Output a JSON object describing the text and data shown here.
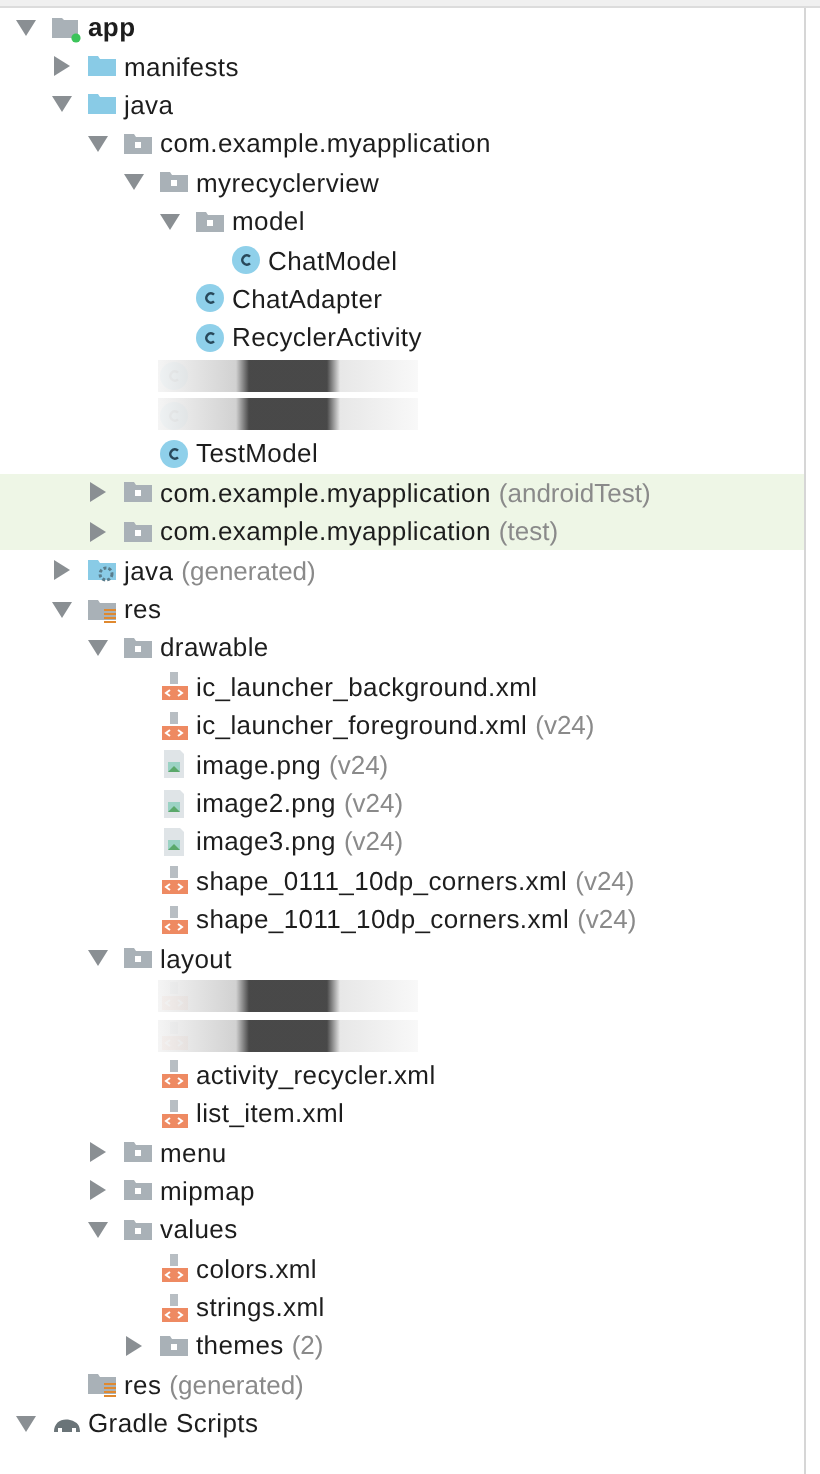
{
  "tree": [
    {
      "kind": "module",
      "label": "app",
      "expanded": true,
      "children": [
        {
          "kind": "folder",
          "label": "manifests",
          "expanded": false
        },
        {
          "kind": "folder",
          "label": "java",
          "expanded": true,
          "children": [
            {
              "kind": "package",
              "label": "com.example.myapplication",
              "expanded": true,
              "children": [
                {
                  "kind": "package",
                  "label": "myrecyclerview",
                  "expanded": true,
                  "children": [
                    {
                      "kind": "package",
                      "label": "model",
                      "expanded": true,
                      "children": [
                        {
                          "kind": "class",
                          "label": "ChatModel"
                        }
                      ]
                    },
                    {
                      "kind": "class",
                      "label": "ChatAdapter"
                    },
                    {
                      "kind": "class",
                      "label": "RecyclerActivity"
                    }
                  ]
                },
                {
                  "kind": "class",
                  "redacted": true
                },
                {
                  "kind": "class",
                  "redacted": true
                },
                {
                  "kind": "class",
                  "label": "TestModel"
                }
              ]
            },
            {
              "kind": "package",
              "label": "com.example.myapplication",
              "suffix": "(androidTest)",
              "expanded": false,
              "highlighted": true
            },
            {
              "kind": "package",
              "label": "com.example.myapplication",
              "suffix": "(test)",
              "expanded": false,
              "highlighted": true
            }
          ]
        },
        {
          "kind": "generated",
          "label": "java",
          "suffix": "(generated)",
          "expanded": false
        },
        {
          "kind": "res",
          "label": "res",
          "expanded": true,
          "children": [
            {
              "kind": "package",
              "label": "drawable",
              "expanded": true,
              "children": [
                {
                  "kind": "xml",
                  "label": "ic_launcher_background.xml"
                },
                {
                  "kind": "xml",
                  "label": "ic_launcher_foreground.xml",
                  "suffix": "(v24)"
                },
                {
                  "kind": "image",
                  "label": "image.png",
                  "suffix": "(v24)"
                },
                {
                  "kind": "image",
                  "label": "image2.png",
                  "suffix": "(v24)"
                },
                {
                  "kind": "image",
                  "label": "image3.png",
                  "suffix": "(v24)"
                },
                {
                  "kind": "xml",
                  "label": "shape_0111_10dp_corners.xml",
                  "suffix": "(v24)"
                },
                {
                  "kind": "xml",
                  "label": "shape_1011_10dp_corners.xml",
                  "suffix": "(v24)"
                }
              ]
            },
            {
              "kind": "package",
              "label": "layout",
              "expanded": true,
              "children": [
                {
                  "kind": "xml",
                  "redacted": true
                },
                {
                  "kind": "xml",
                  "redacted": true
                },
                {
                  "kind": "xml",
                  "label": "activity_recycler.xml"
                },
                {
                  "kind": "xml",
                  "label": "list_item.xml"
                }
              ]
            },
            {
              "kind": "package",
              "label": "menu",
              "expanded": false
            },
            {
              "kind": "package",
              "label": "mipmap",
              "expanded": false
            },
            {
              "kind": "package",
              "label": "values",
              "expanded": true,
              "children": [
                {
                  "kind": "xml",
                  "label": "colors.xml"
                },
                {
                  "kind": "xml",
                  "label": "strings.xml"
                },
                {
                  "kind": "package",
                  "label": "themes",
                  "suffix": "(2)",
                  "expanded": false
                }
              ]
            }
          ]
        },
        {
          "kind": "res",
          "label": "res",
          "suffix": "(generated)"
        }
      ]
    },
    {
      "kind": "gradle",
      "label": "Gradle Scripts",
      "expanded": true
    }
  ]
}
